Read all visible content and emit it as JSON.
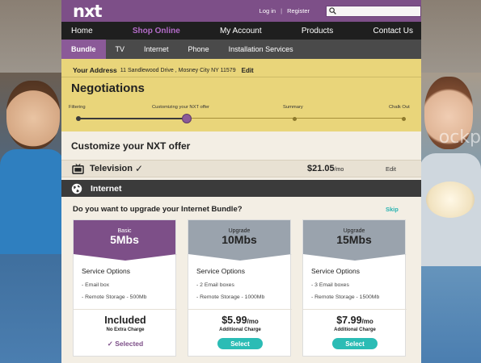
{
  "header": {
    "logo": "nxt",
    "login": "Log in",
    "separator": "|",
    "register": "Register",
    "search_placeholder": ""
  },
  "main_nav": [
    "Home",
    "Shop Online",
    "My Account",
    "Products",
    "Contact Us"
  ],
  "sub_nav": [
    "Bundle",
    "TV",
    "Internet",
    "Phone",
    "Installation Services"
  ],
  "address": {
    "label": "Your Address",
    "value": "11 Sandlewood Drive , Mosney City NY 11579",
    "edit": "Edit"
  },
  "page_title": "Negotiations",
  "progress_steps": [
    "Filtering",
    "Customizing your NXT offer",
    "Summary",
    "Chalk Out"
  ],
  "customize_title": "Customize your NXT offer",
  "television": {
    "name": "Television",
    "check": "✓",
    "price": "$21.05",
    "per": "/mo",
    "edit": "Edit"
  },
  "internet_bar": "Internet",
  "upgrade_question": "Do you want to upgrade your Internet Bundle?",
  "skip": "Skip",
  "cards": [
    {
      "tag": "Basic",
      "speed": "5Mbs",
      "options_title": "Service Options",
      "items": [
        "- Email box",
        "- Remote Storage - 500Mb"
      ],
      "price": "Included",
      "price_sub": "No Extra Charge",
      "action": "✓ Selected"
    },
    {
      "tag": "Upgrade",
      "speed": "10Mbs",
      "options_title": "Service Options",
      "items": [
        "- 2 Email boxes",
        "- Remote Storage - 1000Mb"
      ],
      "price": "$5.99",
      "per": "/mo",
      "price_sub": "Additional Charge",
      "action": "Select"
    },
    {
      "tag": "Upgrade",
      "speed": "15Mbs",
      "options_title": "Service Options",
      "items": [
        "- 3 Email boxes",
        "- Remote Storage - 1500Mb"
      ],
      "price": "$7.99",
      "per": "/mo",
      "price_sub": "Additional Charge",
      "action": "Select"
    }
  ],
  "watermark": "ockp",
  "colors": {
    "brand_purple": "#7d4f88",
    "accent_teal": "#2bbcb5",
    "highlight_yellow": "#e9d57a"
  }
}
